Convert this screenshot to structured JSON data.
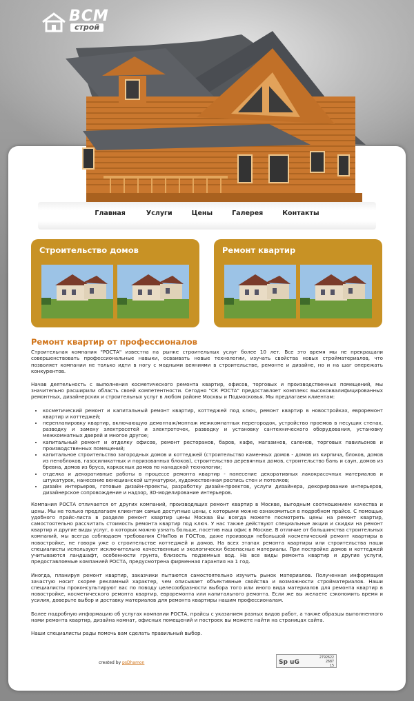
{
  "logo": {
    "brand": "ВСМ",
    "sub": "строй",
    "icon": "house-icon"
  },
  "nav": {
    "items": [
      "Главная",
      "Услуги",
      "Цены",
      "Галерея",
      "Контакты"
    ]
  },
  "boxes": [
    {
      "title": "Строительство домов"
    },
    {
      "title": "Ремонт квартир"
    }
  ],
  "article": {
    "heading": "Ремонт квартир от профессионалов",
    "p1": "Строительная компания \"РОСТА\" известна на рынке строительных услуг более 10 лет. Все это время мы не прекращали совершенствовать профессиональные навыки, осваивать новые технологии, изучать свойства новых стройматериалов, что позволяет компании не только идти в ногу с модными веяниями в строительстве, ремонте и дизайне, но и на шаг опережать конкурентов.",
    "p2": "Начав деятельность с выполнения косметического ремонта квартир, офисов, торговых и производственных помещений, мы значительно расширили область своей компетентности. Сегодня \"СК РОСТА\" предоставляет комплекс высококвалифицированных ремонтных, дизайнерских и строительных услуг в любом районе Москвы и Подмосковья. Мы предлагаем клиентам:",
    "list": [
      "косметический ремонт и капитальный ремонт квартир, коттеджей под ключ, ремонт квартир в новостройках, евроремонт квартир и коттеджей;",
      "перепланировку квартир, включающую демонтаж/монтаж межкомнатных перегородок, устройство проемов в несущих стенах, разводку и замену электросетей и электроточек, разводку и установку сантехнического оборудования, установку межкомнатных дверей и многое другое;",
      "капитальный ремонт и отделку офисов, ремонт ресторанов, баров, кафе, магазинов, салонов, торговых павильонов и производственных помещений;",
      "капитальное строительство загородных домов и коттеджей (строительство каменных домов - домов из кирпича, блоков, домов из пеноблоков, газосиликатных и поризованных блоков), строительство деревянных домов, строительство бань и саун, домов из бревна, домов из бруса, каркасных домов по канадской технологии;",
      "отделка и декоративные работы в процессе ремонта квартир - нанесение декоративных лакокрасочных материалов и штукатурок, нанесение венецианской штукатурки, художественная роспись стен и потолков;",
      "дизайн интерьеров, готовые дизайн-проекты, разработку дизайн-проектов, услуги дизайнера, декорирование интерьеров, дизайнерское сопровождение и надзор, 3D-моделирование интерьеров."
    ],
    "p3": "Компания РОСТА отличается от других компаний, производящих ремонт квартир в Москве, выгодным соотношением качества и цены. Мы не только предлагаем клиентам самые доступные цены, с которыми можно ознакомиться в подробном прайсе. С помощью удобного прайс-листа в разделе ремонт квартир цены Москва Вы всегда можете посмотреть цены на ремонт квартир, самостоятельно рассчитать стоимость ремонта квартир под ключ. У нас также действуют специальные акции и скидки на ремонт квартир и другие виды услуг, о которых можно узнать больше, посетив наш офис в Москве. В отличие от большинства строительных компаний, мы всегда соблюдаем требования СНиПов и ГОСТов, даже производя небольшой косметический ремонт квартиры в новостройке, не говоря уже о строительстве коттеджей и домов. На всех этапах ремонта квартиры или строительства наши специалисты используют исключительно качественные и экологически безопасные материалы. При постройке домов и коттеджей учитываются ландшафт, особенности грунта, близость подземных вод. На все виды ремонта квартир и другие услуги, предоставляемые компанией РОСТА, предусмотрена фирменная гарантия на 1 год.",
    "p4": "Иногда, планируя ремонт квартир, заказчики пытаются самостоятельно изучить рынок материалов. Полученная информация зачастую носит скорее рекламный характер, чем описывает объективные свойства и возможности стройматериалов. Наши специалисты проконсультируют вас по поводу целесообразности выбора того или иного вида материалов для ремонта квартир в новостройке, косметического ремонта квартир, евроремонта или капитального ремонта. Если же вы желаете сэкономить время и усилия, доверьте выбор и доставку материалов для ремонта квартиры нашим профессионалам.",
    "p5": "Более подробную информацию об услугах компании РОСТА, прайсы с указанием разных видов работ, а также образцы выполненного нами ремонта квартир, дизайна комнат, офисных помещений и построек вы можете найти на страницах сайта.",
    "p6": "Наши специалисты рады помочь вам сделать правильный выбор."
  },
  "footer": {
    "credit_prefix": "created by",
    "credit_link": "psDhamon",
    "counter_big": "Sp uG",
    "counter_nums": [
      "2792622",
      "2687",
      "15"
    ]
  }
}
